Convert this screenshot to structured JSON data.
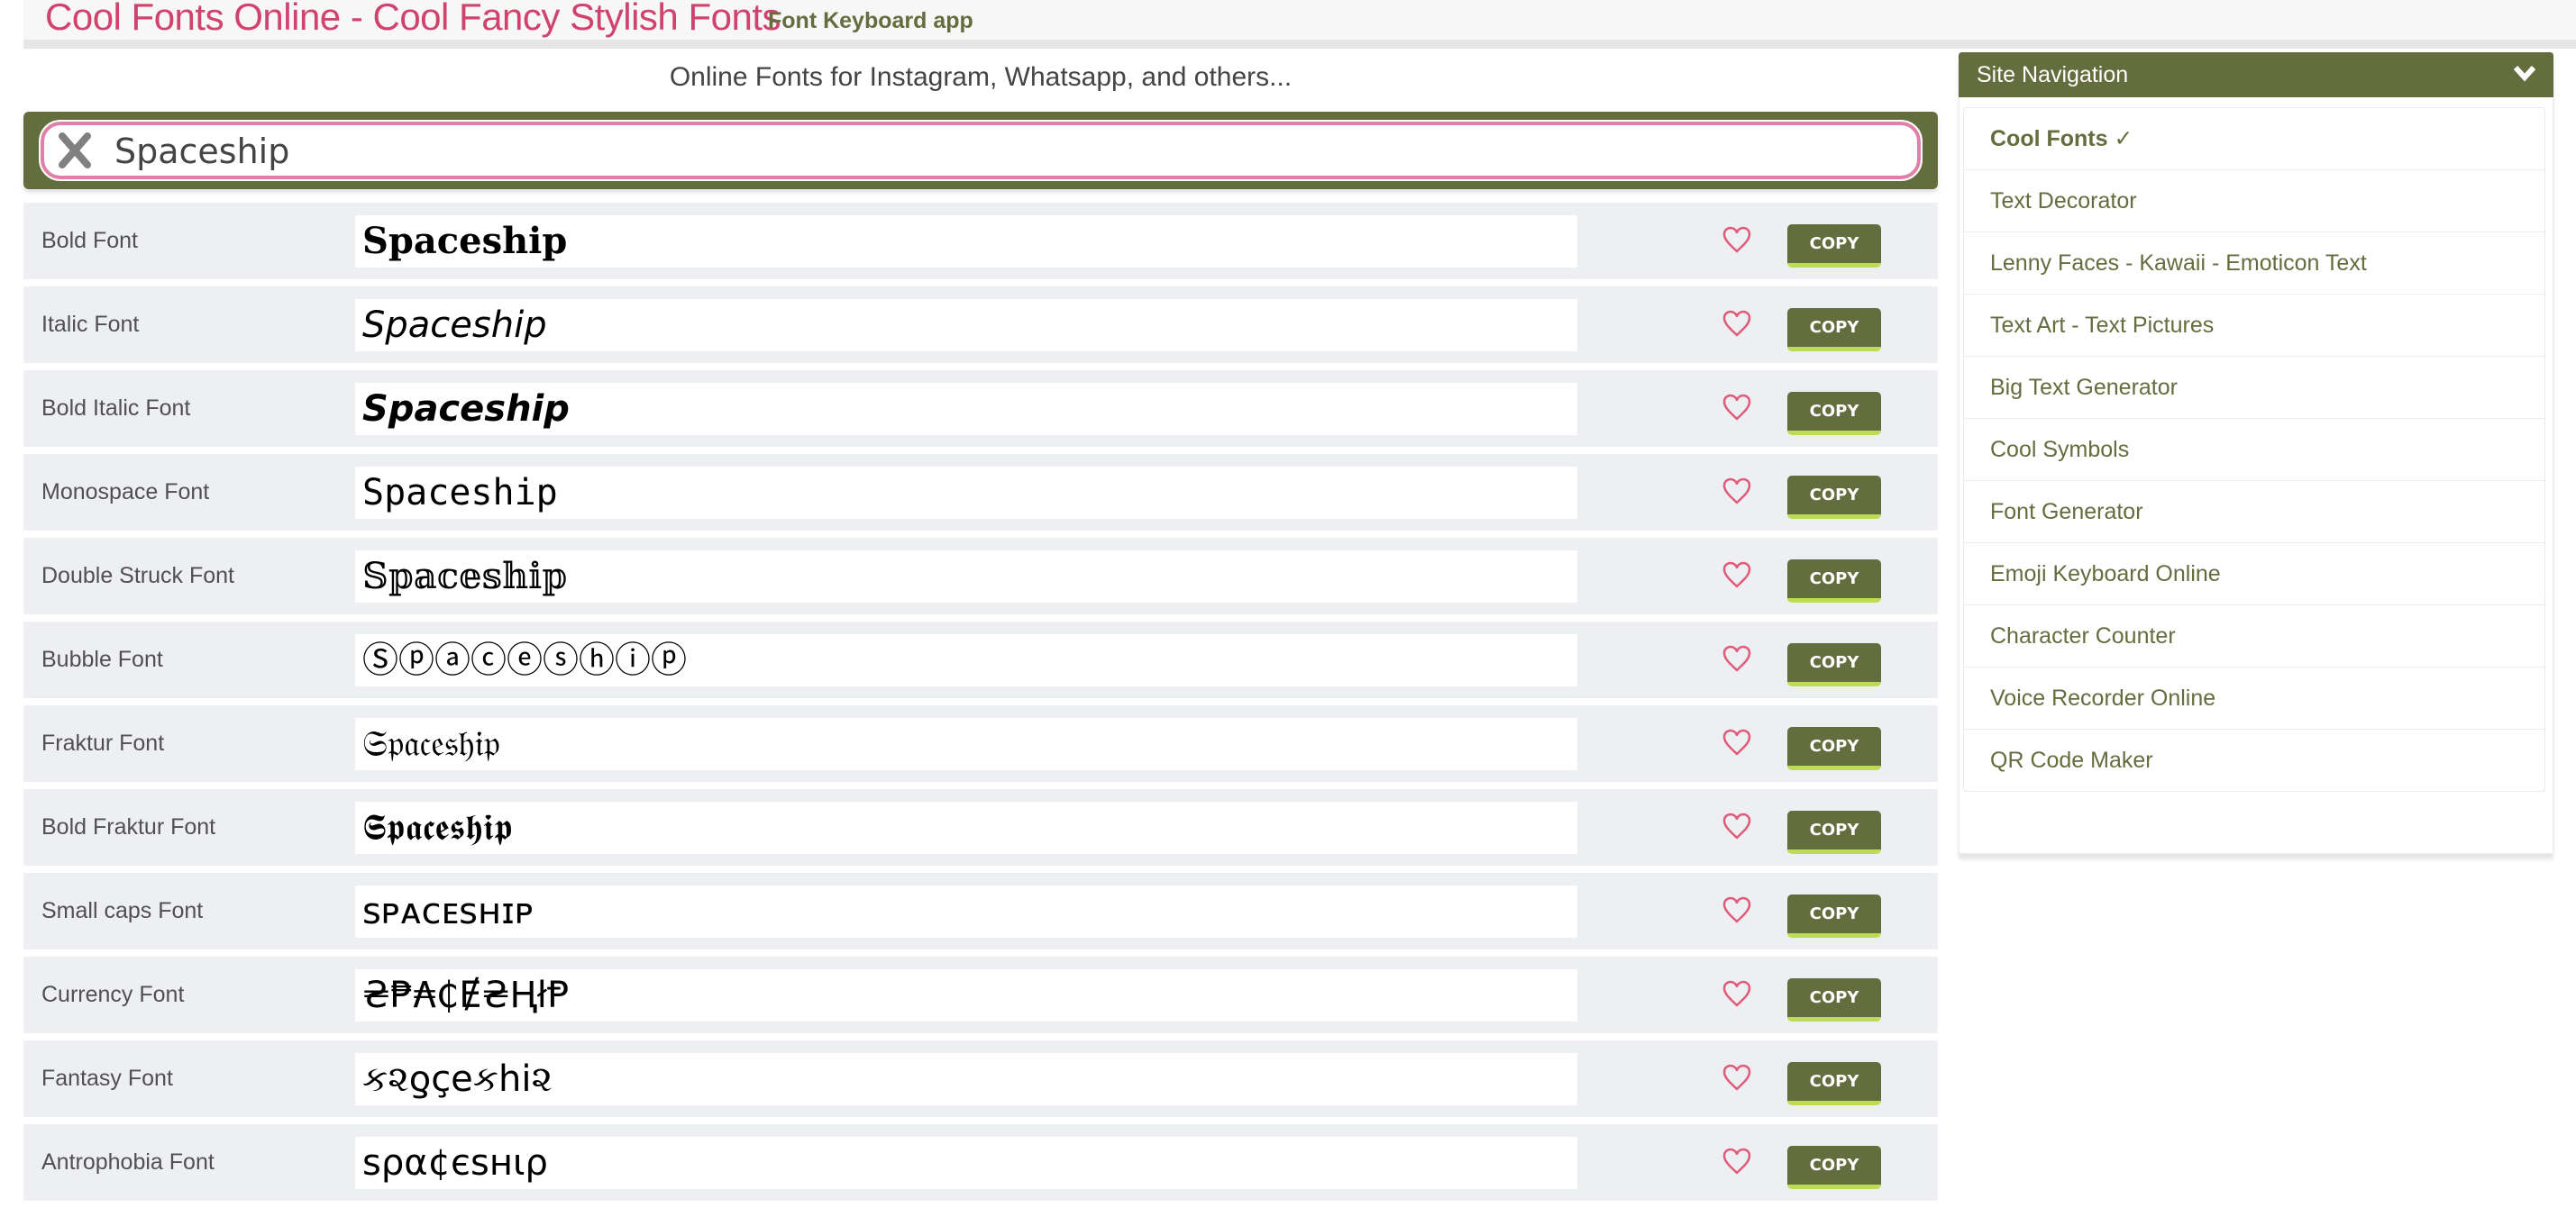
{
  "header": {
    "site_title": "Cool Fonts Online - Cool Fancy Stylish Fonts",
    "app_link": "Font Keyboard app"
  },
  "tagline": "Online Fonts for Instagram, Whatsapp, and others...",
  "search": {
    "value": "Spaceship",
    "clear_icon": "close-x-icon"
  },
  "colors": {
    "brand_olive": "#646d3e",
    "title_pink": "#d0436f",
    "heart_pink": "#e05a7a",
    "copy_accent": "#bddb55",
    "row_bg": "#eeeff3"
  },
  "fonts": [
    {
      "label": "Bold Font",
      "preview": "𝐒𝐩𝐚𝐜𝐞𝐬𝐡𝐢𝐩",
      "style": "f-bold"
    },
    {
      "label": "Italic Font",
      "preview": "𝘚𝘱𝘢𝘤𝘦𝘴𝘩𝘪𝘱",
      "style": "f-italic"
    },
    {
      "label": "Bold Italic Font",
      "preview": "𝙎𝙥𝙖𝙘𝙚𝙨𝙝𝙞𝙥",
      "style": "f-bolditalic"
    },
    {
      "label": "Monospace Font",
      "preview": "𝚂𝚙𝚊𝚌𝚎𝚜𝚑𝚒𝚙",
      "style": "f-mono"
    },
    {
      "label": "Double Struck Font",
      "preview": "𝕊𝕡𝕒𝕔𝕖𝕤𝕙𝕚𝕡",
      "style": "f-serif"
    },
    {
      "label": "Bubble Font",
      "preview": "Ⓢⓟⓐⓒⓔⓢⓗⓘⓟ",
      "style": "f-sans"
    },
    {
      "label": "Fraktur Font",
      "preview": "𝔖𝔭𝔞𝔠𝔢𝔰𝔥𝔦𝔭",
      "style": "f-serif"
    },
    {
      "label": "Bold Fraktur Font",
      "preview": "𝕾𝖕𝖆𝖈𝖊𝖘𝖍𝖎𝖕",
      "style": "f-serif"
    },
    {
      "label": "Small caps Font",
      "preview": "ꜱᴘᴀᴄᴇꜱʜɪᴘ",
      "style": "f-sans"
    },
    {
      "label": "Currency Font",
      "preview": "₴₱₳₵Ɇ₴ⱧłⱣ",
      "style": "f-sans"
    },
    {
      "label": "Fantasy Font",
      "preview": "ક૨ƍçeકhi૨",
      "style": "f-sans"
    },
    {
      "label": "Antrophobia Font",
      "preview": "ѕρα¢єѕнιρ",
      "style": "f-sans"
    }
  ],
  "row_actions": {
    "favorite_icon": "heart-outline-icon",
    "copy_label": "COPY"
  },
  "sidebar": {
    "title": "Site Navigation",
    "toggle_icon": "chevron-down-icon",
    "items": [
      {
        "label": "Cool Fonts ✓",
        "active": true
      },
      {
        "label": "Text Decorator",
        "active": false
      },
      {
        "label": "Lenny Faces - Kawaii - Emoticon Text",
        "active": false
      },
      {
        "label": "Text Art - Text Pictures",
        "active": false
      },
      {
        "label": "Big Text Generator",
        "active": false
      },
      {
        "label": "Cool Symbols",
        "active": false
      },
      {
        "label": "Font Generator",
        "active": false
      },
      {
        "label": "Emoji Keyboard Online",
        "active": false
      },
      {
        "label": "Character Counter",
        "active": false
      },
      {
        "label": "Voice Recorder Online",
        "active": false
      },
      {
        "label": "QR Code Maker",
        "active": false
      }
    ]
  }
}
